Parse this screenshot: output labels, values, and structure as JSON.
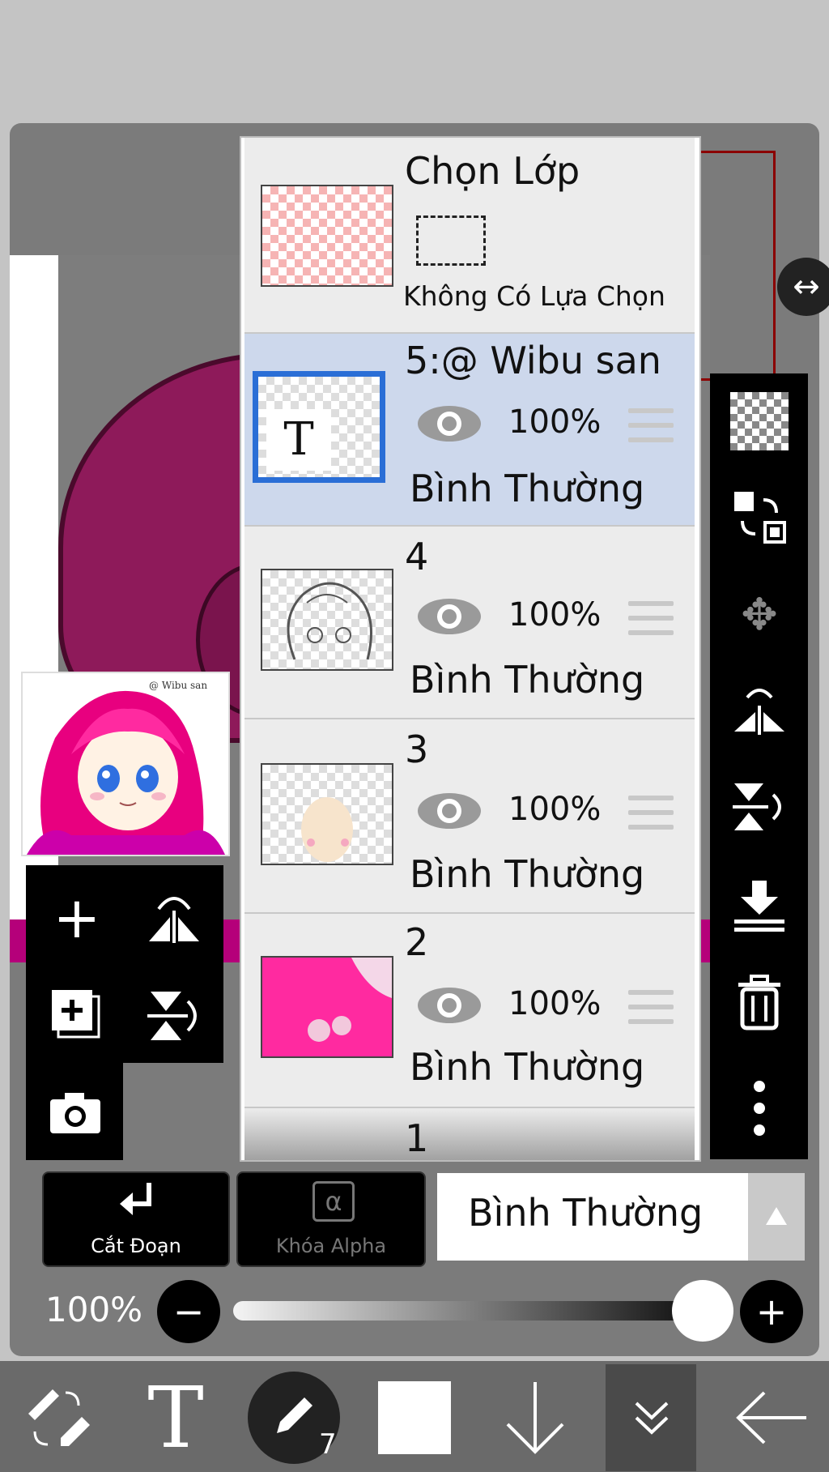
{
  "layer_panel": {
    "selection_layer": {
      "title": "Chọn Lớp",
      "status": "Không Có Lựa Chọn"
    },
    "layers": [
      {
        "name": "5:@ Wibu san",
        "opacity": "100%",
        "blend": "Bình Thường",
        "selected": true,
        "thumb_text": "T"
      },
      {
        "name": "4",
        "opacity": "100%",
        "blend": "Bình Thường",
        "selected": false
      },
      {
        "name": "3",
        "opacity": "100%",
        "blend": "Bình Thường",
        "selected": false
      },
      {
        "name": "2",
        "opacity": "100%",
        "blend": "Bình Thường",
        "selected": false
      },
      {
        "name": "1"
      }
    ]
  },
  "preview": {
    "watermark": "@ Wibu san"
  },
  "controls": {
    "clipping_label": "Cắt Đoạn",
    "alpha_lock_label": "Khóa Alpha",
    "alpha_symbol": "α",
    "blend_mode": "Bình Thường",
    "opacity_label": "100%",
    "opacity_value": 1.0
  },
  "bottom_toolbar": {
    "brush_size": "7",
    "text_tool_glyph": "T"
  },
  "icons": {
    "right_bar": [
      "checker-icon",
      "swap-layers-icon",
      "move-icon",
      "flip-horizontal-icon",
      "flip-vertical-icon",
      "merge-down-icon",
      "trash-icon",
      "more-icon"
    ],
    "left_tools": [
      "add-layer-icon",
      "flip-h-rotate-icon",
      "duplicate-layer-icon",
      "flip-v-rotate-icon",
      "camera-icon"
    ]
  },
  "colors": {
    "selected_row": "#cdd8ec",
    "selected_border": "#2a6ed6",
    "panel_bg": "#7b7b7b",
    "toolbar_bg": "#000000"
  }
}
